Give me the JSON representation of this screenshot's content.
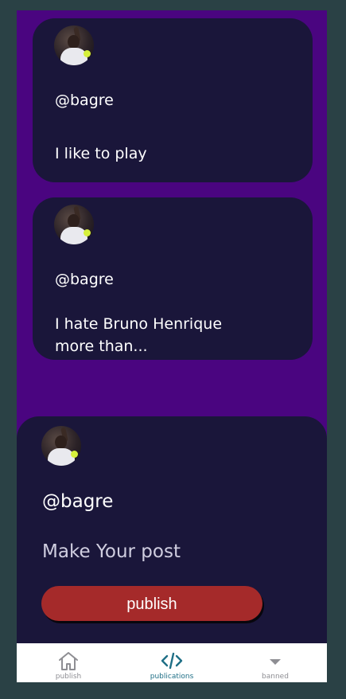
{
  "feed": {
    "posts": [
      {
        "handle": "@bagre",
        "text": "I like to play"
      },
      {
        "handle": "@bagre",
        "text": "I hate Bruno Henrique more than..."
      }
    ]
  },
  "composer": {
    "handle": "@bagre",
    "placeholder": "Make Your post",
    "publish_label": "publish"
  },
  "tabbar": {
    "tabs": [
      {
        "label": "publish",
        "icon": "home-icon"
      },
      {
        "label": "publications",
        "icon": "code-icon",
        "active": true
      },
      {
        "label": "banned",
        "icon": "caret-down-icon"
      }
    ]
  },
  "colors": {
    "page_background": "#2a4145",
    "app_background": "#4a0580",
    "card_background": "#1a163a",
    "publish_button": "#a52a2a",
    "active_tab": "#1f6f86"
  }
}
